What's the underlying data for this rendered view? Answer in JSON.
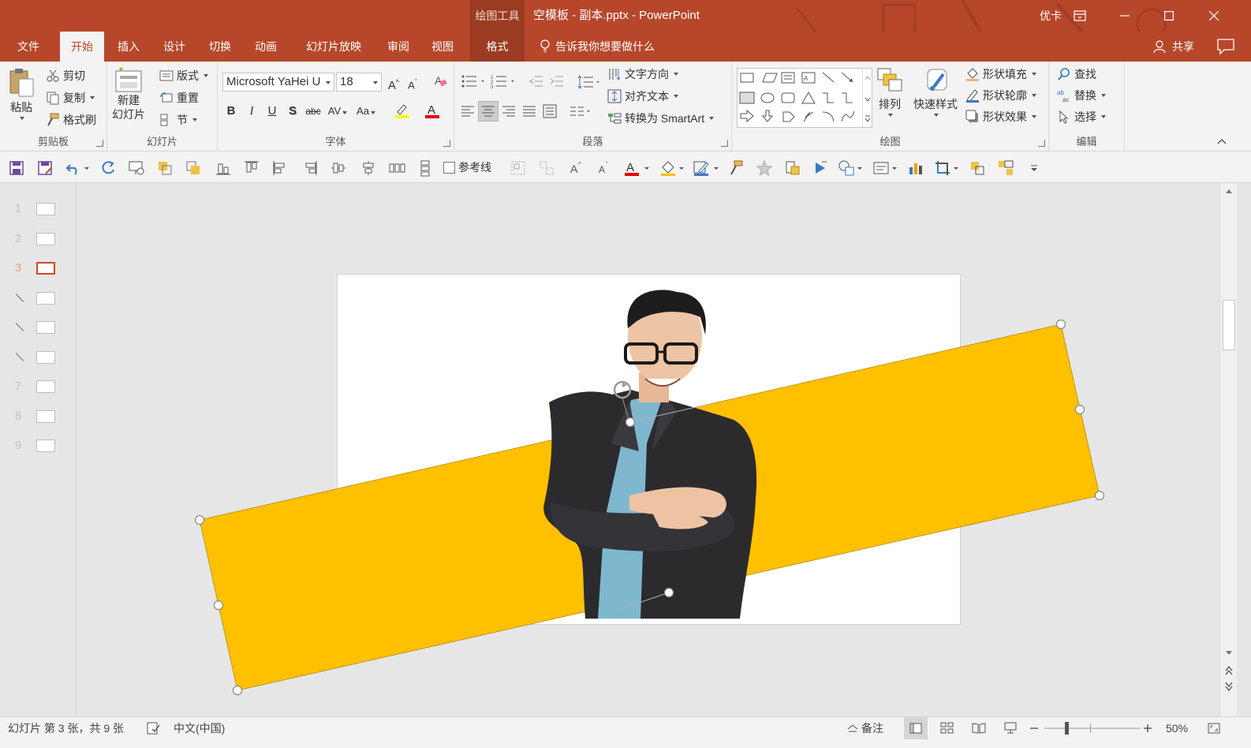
{
  "titlebar": {
    "context_tools": "绘图工具",
    "title": "空模板 - 副本.pptx  -  PowerPoint",
    "user": "优卡"
  },
  "tabs": [
    "文件",
    "开始",
    "插入",
    "设计",
    "切换",
    "动画",
    "幻灯片放映",
    "审阅",
    "视图",
    "格式"
  ],
  "active_tab": "开始",
  "tell_me": "告诉我你想要做什么",
  "share": "共享",
  "ribbon": {
    "clipboard": {
      "paste": "粘贴",
      "cut": "剪切",
      "copy": "复制",
      "format_painter": "格式刷",
      "label": "剪贴板"
    },
    "slides": {
      "new_slide_1": "新建",
      "new_slide_2": "幻灯片",
      "layout": "版式",
      "reset": "重置",
      "section": "节",
      "label": "幻灯片"
    },
    "font": {
      "name": "Microsoft YaHei U",
      "size": "18",
      "label": "字体"
    },
    "paragraph": {
      "text_direction": "文字方向",
      "align_text": "对齐文本",
      "smartart": "转换为 SmartArt",
      "label": "段落"
    },
    "drawing": {
      "arrange": "排列",
      "quick_styles": "快速样式",
      "shape_fill": "形状填充",
      "shape_outline": "形状轮廓",
      "shape_effects": "形状效果",
      "label": "绘图"
    },
    "editing": {
      "find": "查找",
      "replace": "替换",
      "select": "选择",
      "label": "编辑"
    }
  },
  "qat": {
    "guides": "参考线"
  },
  "thumbnails": [
    {
      "num": "1",
      "hidden": false
    },
    {
      "num": "2",
      "hidden": false
    },
    {
      "num": "3",
      "hidden": false
    },
    {
      "num": "4",
      "hidden": true
    },
    {
      "num": "5",
      "hidden": true
    },
    {
      "num": "6",
      "hidden": true
    },
    {
      "num": "7",
      "hidden": false
    },
    {
      "num": "8",
      "hidden": false
    },
    {
      "num": "9",
      "hidden": false
    }
  ],
  "current_slide": "3",
  "status": {
    "slide_info": "幻灯片 第 3 张，共 9 张",
    "language": "中文(中国)",
    "notes": "备注",
    "zoom": "50%"
  },
  "colors": {
    "brand": "#b7472a",
    "shape_fill": "#ffc000",
    "ribbon_bg": "#f3f3f3"
  }
}
